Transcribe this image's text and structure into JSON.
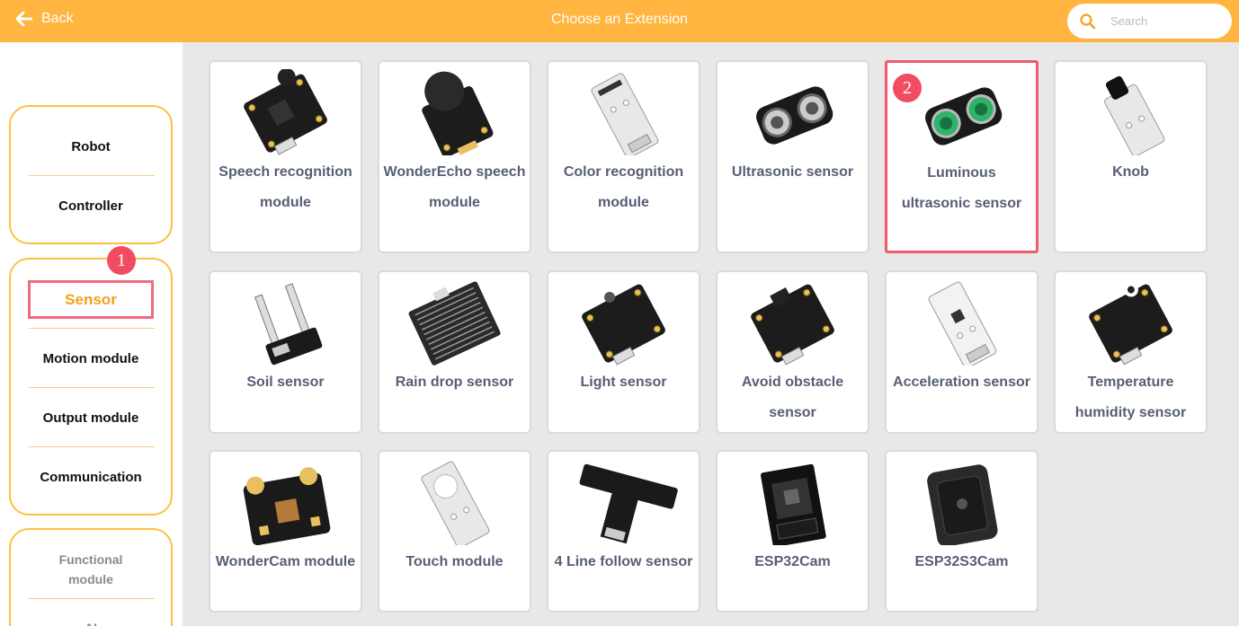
{
  "header": {
    "back_label": "Back",
    "title": "Choose an Extension",
    "search_placeholder": "Search",
    "accent_color": "#ffb53f"
  },
  "sidebar": {
    "group1": [
      "Robot",
      "Controller"
    ],
    "group2": [
      "Sensor",
      "Motion module",
      "Output module",
      "Communication"
    ],
    "group3_functional": "Functional module",
    "group3_partial": "AI",
    "selected": "Sensor",
    "badge": "1"
  },
  "cards": [
    {
      "label": "Speech recognition module",
      "icon": "speech-board-icon"
    },
    {
      "label": "WonderEcho speech module",
      "icon": "speaker-board-icon"
    },
    {
      "label": "Color recognition module",
      "icon": "grey-board-icon"
    },
    {
      "label": "Ultrasonic sensor",
      "icon": "ultrasonic-icon"
    },
    {
      "label": "Luminous ultrasonic sensor",
      "icon": "luminous-ultrasonic-icon",
      "selected": true,
      "badge": "2"
    },
    {
      "label": "Knob",
      "icon": "knob-icon"
    },
    {
      "label": "Soil sensor",
      "icon": "soil-probe-icon"
    },
    {
      "label": "Rain drop sensor",
      "icon": "rain-board-icon"
    },
    {
      "label": "Light sensor",
      "icon": "light-board-icon"
    },
    {
      "label": "Avoid obstacle sensor",
      "icon": "obstacle-board-icon"
    },
    {
      "label": "Acceleration sensor",
      "icon": "accel-board-icon"
    },
    {
      "label": "Temperature humidity sensor",
      "icon": "temp-board-icon"
    },
    {
      "label": "WonderCam module",
      "icon": "camera-module-icon"
    },
    {
      "label": "Touch module",
      "icon": "touch-board-icon"
    },
    {
      "label": "4 Line follow sensor",
      "icon": "line-follow-icon"
    },
    {
      "label": "ESP32Cam",
      "icon": "esp32cam-icon"
    },
    {
      "label": "ESP32S3Cam",
      "icon": "esp32s3cam-icon"
    }
  ]
}
